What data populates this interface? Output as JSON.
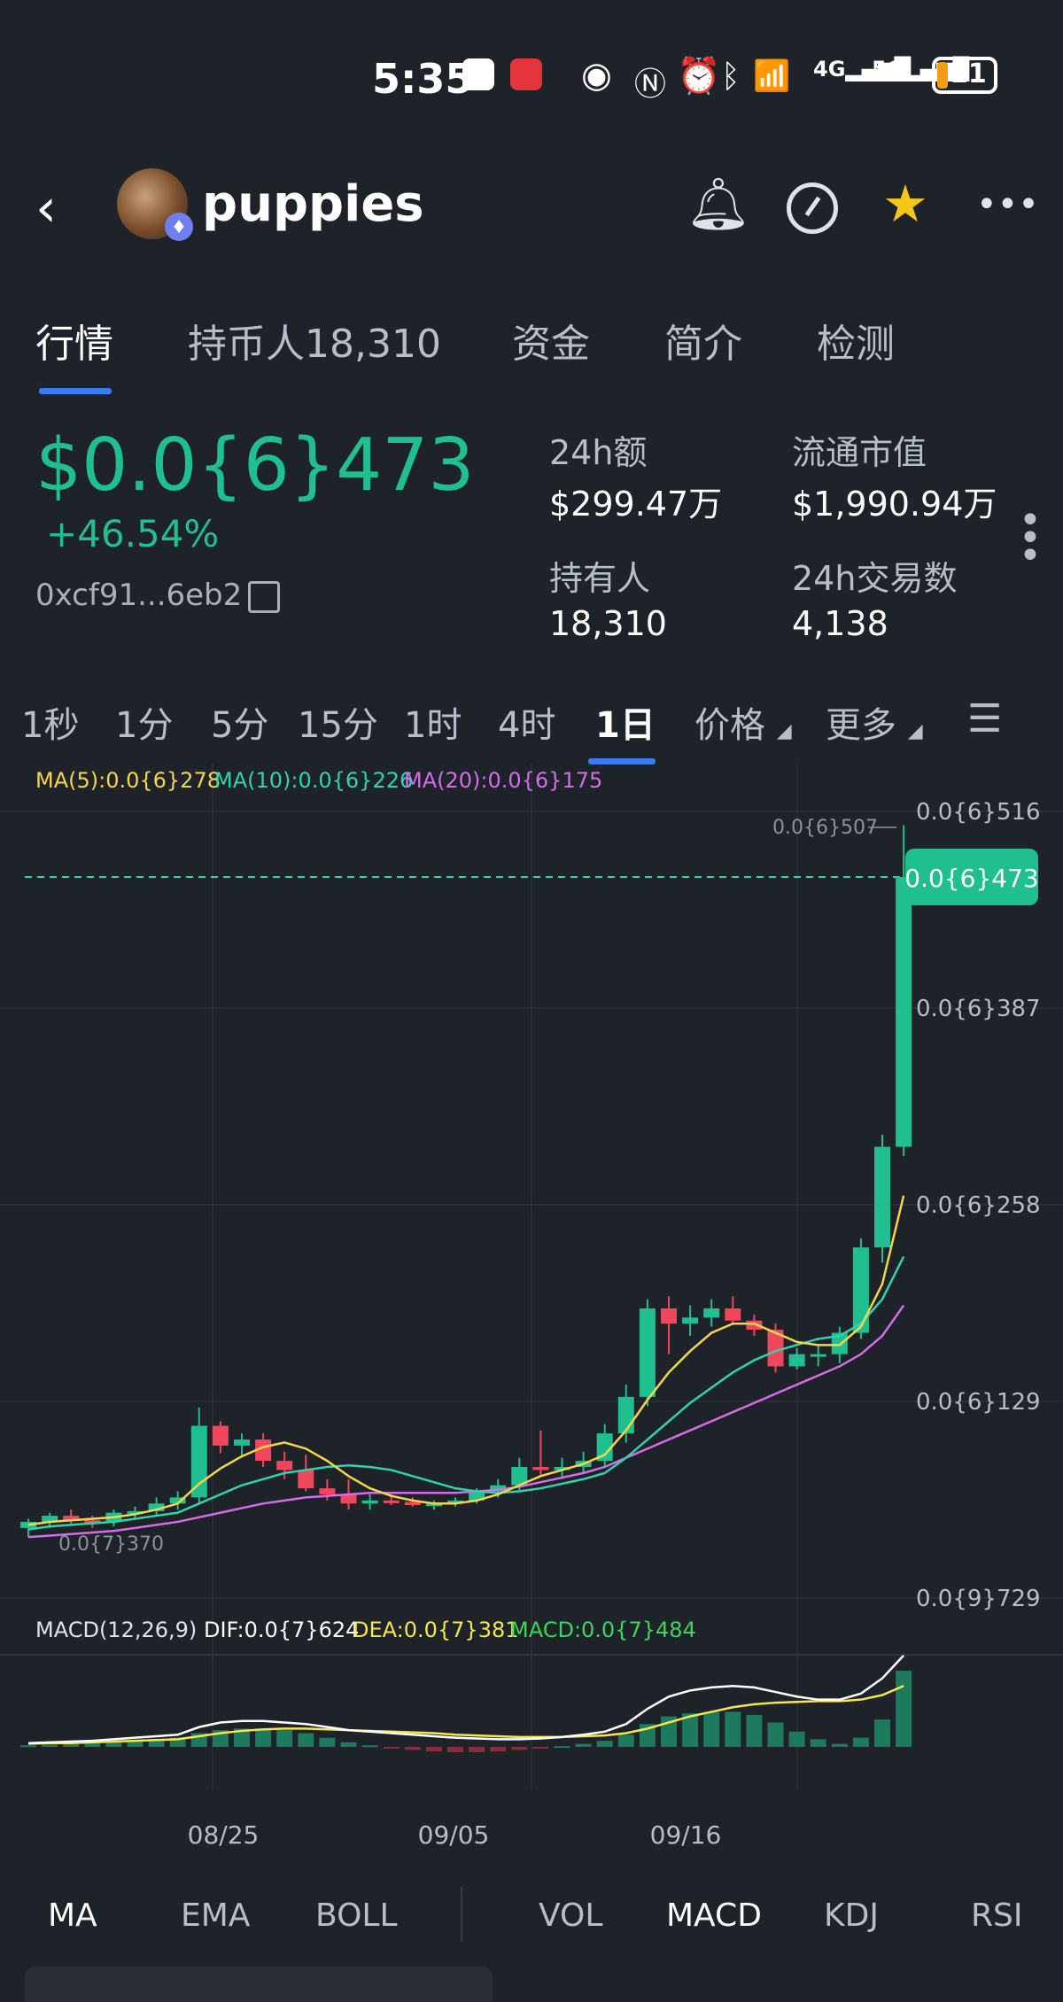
{
  "status_bar": {
    "time": "5:35",
    "battery": "11",
    "icons": [
      "app-icon",
      "huawei-icon",
      "eye-icon",
      "nfc-icon",
      "alarm-icon",
      "bluetooth-icon",
      "wifi-icon",
      "signal-4g-icon",
      "signal-5g-icon",
      "battery-icon"
    ]
  },
  "header": {
    "token_name": "puppies",
    "icons": [
      "back-icon",
      "bell-icon",
      "gauge-icon",
      "star-icon",
      "more-icon"
    ]
  },
  "tabs": [
    "行情",
    "持币人18,310",
    "资金",
    "简介",
    "检测"
  ],
  "price": {
    "value": "$0.0{6}473",
    "change": "+46.54%",
    "address": "0xcf91...6eb2"
  },
  "stats": [
    {
      "label": "24h额",
      "value": "$299.47万"
    },
    {
      "label": "流通市值",
      "value": "$1,990.94万"
    },
    {
      "label": "持有人",
      "value": "18,310"
    },
    {
      "label": "24h交易数",
      "value": "4,138"
    }
  ],
  "intervals": [
    "1秒",
    "1分",
    "5分",
    "15分",
    "1时",
    "4时",
    "1日",
    "价格",
    "更多"
  ],
  "active_interval": "1日",
  "ma_legend": {
    "ma5": "MA(5):0.0{6}278",
    "ma10": "MA(10):0.0{6}226",
    "ma20": "MA(20):0.0{6}175"
  },
  "macd_legend": {
    "title": "MACD(12,26,9)",
    "dif": "DIF:0.0{7}624",
    "dea": "DEA:0.0{7}381",
    "macd": "MACD:0.0{7}484"
  },
  "chart_data": {
    "type": "candlestick",
    "y_ticks": [
      "0.0{6}516",
      "0.0{6}387",
      "0.0{6}258",
      "0.0{6}129",
      "0.0{9}729"
    ],
    "current_price_label": "0.0{6}473",
    "high_label": "0.0{6}507",
    "low_label": "0.0{7}370",
    "x_ticks": [
      "08/25",
      "09/05",
      "09/16"
    ],
    "colors": {
      "up": "#1fbf8f",
      "down": "#f0475c",
      "ma5": "#f5d54a",
      "ma10": "#2fd3b0",
      "ma20": "#d46ee8",
      "dif": "#ffffff",
      "dea": "#f5e74a"
    },
    "candles": [
      {
        "o": 0.46,
        "h": 0.52,
        "l": 0.4,
        "c": 0.5
      },
      {
        "o": 0.5,
        "h": 0.56,
        "l": 0.46,
        "c": 0.54
      },
      {
        "o": 0.54,
        "h": 0.58,
        "l": 0.48,
        "c": 0.51
      },
      {
        "o": 0.51,
        "h": 0.54,
        "l": 0.46,
        "c": 0.5
      },
      {
        "o": 0.5,
        "h": 0.58,
        "l": 0.47,
        "c": 0.56
      },
      {
        "o": 0.56,
        "h": 0.6,
        "l": 0.52,
        "c": 0.57
      },
      {
        "o": 0.57,
        "h": 0.66,
        "l": 0.54,
        "c": 0.62
      },
      {
        "o": 0.62,
        "h": 0.7,
        "l": 0.58,
        "c": 0.66
      },
      {
        "o": 0.66,
        "h": 1.25,
        "l": 0.62,
        "c": 1.13
      },
      {
        "o": 1.13,
        "h": 1.16,
        "l": 0.95,
        "c": 1.0
      },
      {
        "o": 1.0,
        "h": 1.08,
        "l": 0.92,
        "c": 1.04
      },
      {
        "o": 1.04,
        "h": 1.08,
        "l": 0.86,
        "c": 0.9
      },
      {
        "o": 0.9,
        "h": 0.96,
        "l": 0.78,
        "c": 0.84
      },
      {
        "o": 0.84,
        "h": 0.94,
        "l": 0.7,
        "c": 0.72
      },
      {
        "o": 0.72,
        "h": 0.78,
        "l": 0.64,
        "c": 0.68
      },
      {
        "o": 0.68,
        "h": 0.78,
        "l": 0.58,
        "c": 0.62
      },
      {
        "o": 0.62,
        "h": 0.68,
        "l": 0.58,
        "c": 0.64
      },
      {
        "o": 0.64,
        "h": 0.68,
        "l": 0.61,
        "c": 0.63
      },
      {
        "o": 0.63,
        "h": 0.66,
        "l": 0.6,
        "c": 0.61
      },
      {
        "o": 0.61,
        "h": 0.64,
        "l": 0.58,
        "c": 0.62
      },
      {
        "o": 0.62,
        "h": 0.66,
        "l": 0.6,
        "c": 0.64
      },
      {
        "o": 0.64,
        "h": 0.72,
        "l": 0.62,
        "c": 0.7
      },
      {
        "o": 0.7,
        "h": 0.78,
        "l": 0.66,
        "c": 0.74
      },
      {
        "o": 0.74,
        "h": 0.92,
        "l": 0.7,
        "c": 0.86
      },
      {
        "o": 0.86,
        "h": 1.1,
        "l": 0.8,
        "c": 0.84
      },
      {
        "o": 0.84,
        "h": 0.92,
        "l": 0.78,
        "c": 0.86
      },
      {
        "o": 0.86,
        "h": 0.96,
        "l": 0.82,
        "c": 0.9
      },
      {
        "o": 0.9,
        "h": 1.14,
        "l": 0.86,
        "c": 1.08
      },
      {
        "o": 1.08,
        "h": 1.4,
        "l": 1.02,
        "c": 1.32
      },
      {
        "o": 1.32,
        "h": 1.96,
        "l": 1.26,
        "c": 1.9
      },
      {
        "o": 1.9,
        "h": 1.98,
        "l": 1.6,
        "c": 1.8
      },
      {
        "o": 1.8,
        "h": 1.92,
        "l": 1.72,
        "c": 1.84
      },
      {
        "o": 1.84,
        "h": 1.96,
        "l": 1.78,
        "c": 1.9
      },
      {
        "o": 1.9,
        "h": 1.98,
        "l": 1.8,
        "c": 1.82
      },
      {
        "o": 1.82,
        "h": 1.86,
        "l": 1.72,
        "c": 1.76
      },
      {
        "o": 1.76,
        "h": 1.8,
        "l": 1.48,
        "c": 1.52
      },
      {
        "o": 1.52,
        "h": 1.64,
        "l": 1.5,
        "c": 1.6
      },
      {
        "o": 1.6,
        "h": 1.66,
        "l": 1.52,
        "c": 1.6
      },
      {
        "o": 1.6,
        "h": 1.78,
        "l": 1.54,
        "c": 1.74
      },
      {
        "o": 1.74,
        "h": 2.36,
        "l": 1.7,
        "c": 2.3
      },
      {
        "o": 2.3,
        "h": 3.04,
        "l": 2.2,
        "c": 2.96
      },
      {
        "o": 2.96,
        "h": 5.07,
        "l": 2.9,
        "c": 4.73
      }
    ],
    "ma5": [
      0.48,
      0.5,
      0.51,
      0.52,
      0.53,
      0.55,
      0.58,
      0.62,
      0.75,
      0.85,
      0.93,
      0.99,
      1.02,
      0.98,
      0.9,
      0.8,
      0.72,
      0.67,
      0.64,
      0.62,
      0.62,
      0.64,
      0.68,
      0.74,
      0.8,
      0.84,
      0.88,
      0.94,
      1.1,
      1.3,
      1.48,
      1.62,
      1.74,
      1.8,
      1.8,
      1.74,
      1.68,
      1.66,
      1.66,
      1.78,
      2.06,
      2.64
    ],
    "ma10": [
      0.45,
      0.47,
      0.48,
      0.49,
      0.5,
      0.52,
      0.54,
      0.56,
      0.62,
      0.68,
      0.74,
      0.78,
      0.82,
      0.84,
      0.86,
      0.87,
      0.86,
      0.84,
      0.8,
      0.76,
      0.72,
      0.7,
      0.69,
      0.7,
      0.72,
      0.75,
      0.78,
      0.82,
      0.92,
      1.04,
      1.16,
      1.28,
      1.38,
      1.48,
      1.56,
      1.62,
      1.66,
      1.7,
      1.72,
      1.8,
      1.96,
      2.24
    ],
    "ma20": [
      0.4,
      0.41,
      0.42,
      0.43,
      0.44,
      0.46,
      0.48,
      0.5,
      0.53,
      0.56,
      0.59,
      0.62,
      0.64,
      0.66,
      0.67,
      0.68,
      0.69,
      0.69,
      0.69,
      0.69,
      0.69,
      0.7,
      0.71,
      0.73,
      0.76,
      0.79,
      0.82,
      0.86,
      0.92,
      0.98,
      1.04,
      1.1,
      1.16,
      1.22,
      1.28,
      1.34,
      1.4,
      1.46,
      1.52,
      1.6,
      1.72,
      1.92
    ],
    "macd_hist": [
      0.02,
      0.03,
      0.04,
      0.05,
      0.06,
      0.08,
      0.1,
      0.12,
      0.18,
      0.22,
      0.24,
      0.24,
      0.22,
      0.18,
      0.12,
      0.06,
      0.02,
      -0.02,
      -0.04,
      -0.06,
      -0.07,
      -0.07,
      -0.06,
      -0.04,
      -0.02,
      0.01,
      0.04,
      0.08,
      0.16,
      0.3,
      0.4,
      0.44,
      0.46,
      0.46,
      0.42,
      0.32,
      0.2,
      0.1,
      0.04,
      0.12,
      0.36,
      1.0
    ],
    "dif": [
      0.05,
      0.06,
      0.07,
      0.08,
      0.1,
      0.12,
      0.14,
      0.16,
      0.26,
      0.32,
      0.34,
      0.34,
      0.32,
      0.3,
      0.26,
      0.22,
      0.2,
      0.18,
      0.16,
      0.14,
      0.12,
      0.11,
      0.1,
      0.1,
      0.11,
      0.13,
      0.16,
      0.2,
      0.3,
      0.5,
      0.66,
      0.74,
      0.78,
      0.8,
      0.78,
      0.72,
      0.66,
      0.62,
      0.62,
      0.7,
      0.9,
      1.2
    ],
    "dea": [
      0.04,
      0.05,
      0.05,
      0.06,
      0.07,
      0.08,
      0.09,
      0.1,
      0.14,
      0.18,
      0.21,
      0.23,
      0.24,
      0.24,
      0.23,
      0.22,
      0.21,
      0.2,
      0.19,
      0.18,
      0.16,
      0.15,
      0.14,
      0.13,
      0.13,
      0.13,
      0.14,
      0.15,
      0.18,
      0.24,
      0.32,
      0.4,
      0.46,
      0.52,
      0.56,
      0.58,
      0.59,
      0.6,
      0.6,
      0.62,
      0.68,
      0.8
    ]
  },
  "bottom_tabs": {
    "left": [
      "MA",
      "EMA",
      "BOLL"
    ],
    "right": [
      "VOL",
      "MACD",
      "KDJ",
      "RSI"
    ],
    "active_left": "MA",
    "active_right": "MACD"
  }
}
